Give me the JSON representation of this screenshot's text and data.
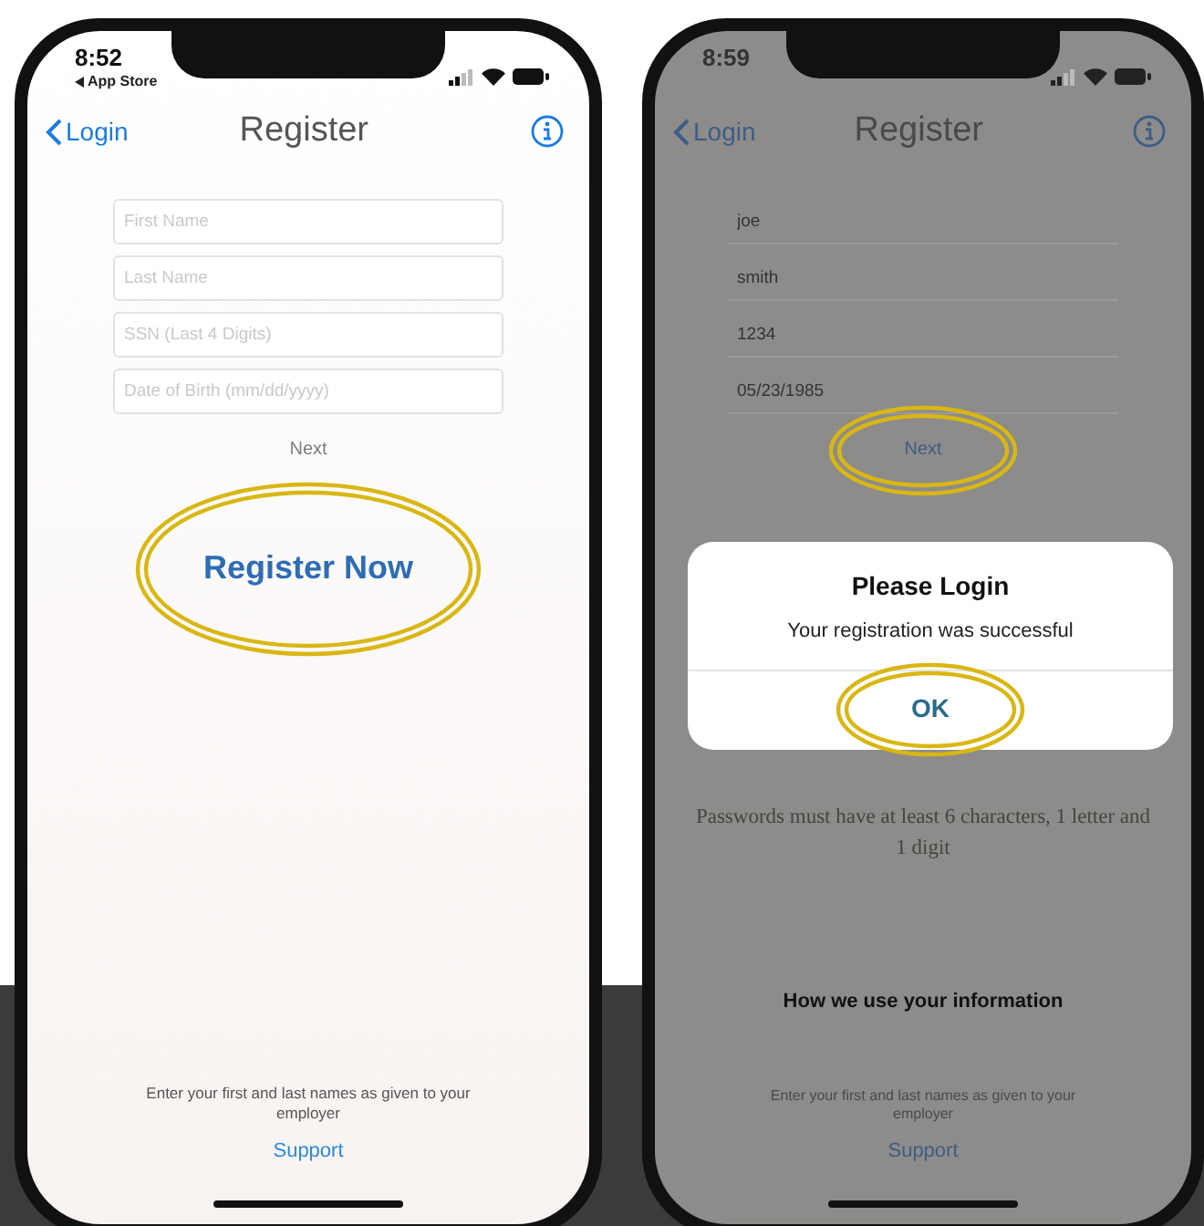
{
  "phones": [
    {
      "dimmed": false,
      "status": {
        "time": "8:52",
        "back_app": "App Store"
      },
      "nav": {
        "back": "Login",
        "title": "Register"
      },
      "fields": [
        {
          "placeholder": "First Name"
        },
        {
          "placeholder": "Last Name"
        },
        {
          "placeholder": "SSN (Last 4 Digits)"
        },
        {
          "placeholder": "Date of Birth (mm/dd/yyyy)"
        }
      ],
      "next": {
        "label": "Next",
        "highlighted": false
      },
      "primary_button": {
        "label": "Register Now",
        "highlighted": true
      },
      "footer": {
        "note": "Enter your first and last names as given to your employer",
        "link": "Support"
      }
    },
    {
      "dimmed": true,
      "status": {
        "time": "8:59"
      },
      "nav": {
        "back": "Login",
        "title": "Register"
      },
      "fields": [
        {
          "value": "joe"
        },
        {
          "value": "smith"
        },
        {
          "value": "1234"
        },
        {
          "value": "05/23/1985"
        }
      ],
      "next": {
        "label": "Next",
        "highlighted": true
      },
      "password_note": "Passwords must have at least 6 characters, 1 letter and 1 digit",
      "footer": {
        "heading": "How we use your information",
        "note": "Enter your first and last names as given to your employer",
        "link": "Support"
      },
      "alert": {
        "title": "Please Login",
        "message": "Your registration was successful",
        "button": {
          "label": "OK",
          "highlighted": true
        }
      }
    }
  ]
}
